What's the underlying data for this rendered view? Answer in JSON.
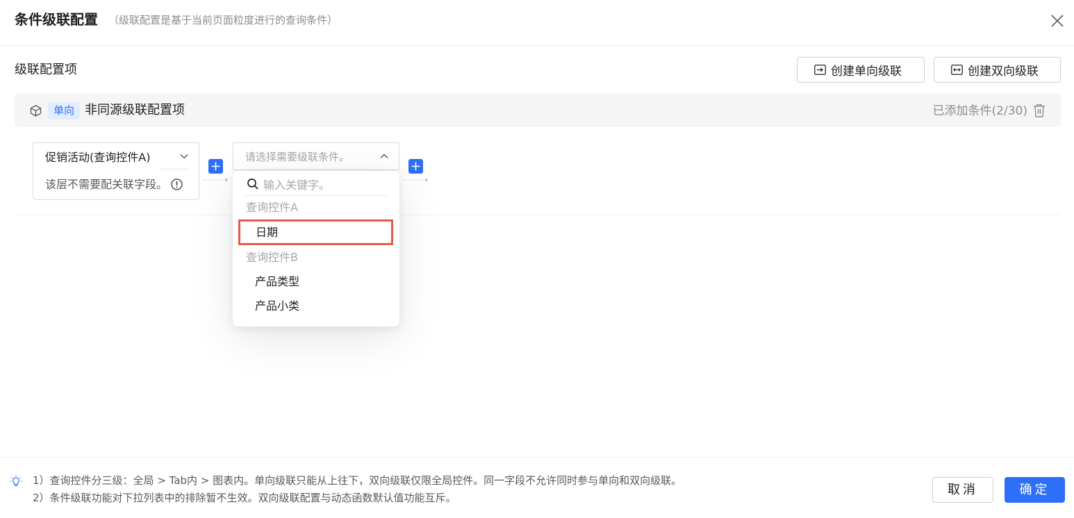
{
  "dialog": {
    "title": "条件级联配置",
    "subtitle": "（级联配置是基于当前页面粒度进行的查询条件）"
  },
  "section": {
    "title": "级联配置项",
    "create_single_label": "创建单向级联",
    "create_double_label": "创建双向级联"
  },
  "config_item": {
    "direction_tag": "单向",
    "name": "非同源级联配置项",
    "added_count": "已添加条件(2/30)"
  },
  "node_a": {
    "selected": "促销活动(查询控件A)",
    "hint": "该层不需要配关联字段。"
  },
  "node_b": {
    "placeholder": "请选择需要级联条件。"
  },
  "dropdown": {
    "search_placeholder": "输入关键字。",
    "groups": [
      {
        "label": "查询控件A",
        "options": [
          "日期"
        ]
      },
      {
        "label": "查询控件B",
        "options": [
          "产品类型",
          "产品小类"
        ]
      }
    ],
    "highlighted_option": "日期"
  },
  "footer": {
    "notes": [
      "1）查询控件分三级：全局 > Tab内 > 图表内。单向级联只能从上往下，双向级联仅限全局控件。同一字段不允许同时参与单向和双向级联。",
      "2）条件级联功能对下拉列表中的排除暂不生效。双向级联配置与动态函数默认值功能互斥。"
    ],
    "cancel_label": "取消",
    "ok_label": "确定"
  },
  "colors": {
    "primary": "#2d6ff6",
    "highlight_border": "#e8584a",
    "tag_bg": "#e3edff"
  },
  "icons": [
    "close-icon",
    "arrow-right-box-icon",
    "double-arrow-box-icon",
    "cube-icon",
    "trash-icon",
    "chevron-down-icon",
    "chevron-up-icon",
    "info-icon",
    "plus-icon",
    "search-icon",
    "lightbulb-icon"
  ]
}
